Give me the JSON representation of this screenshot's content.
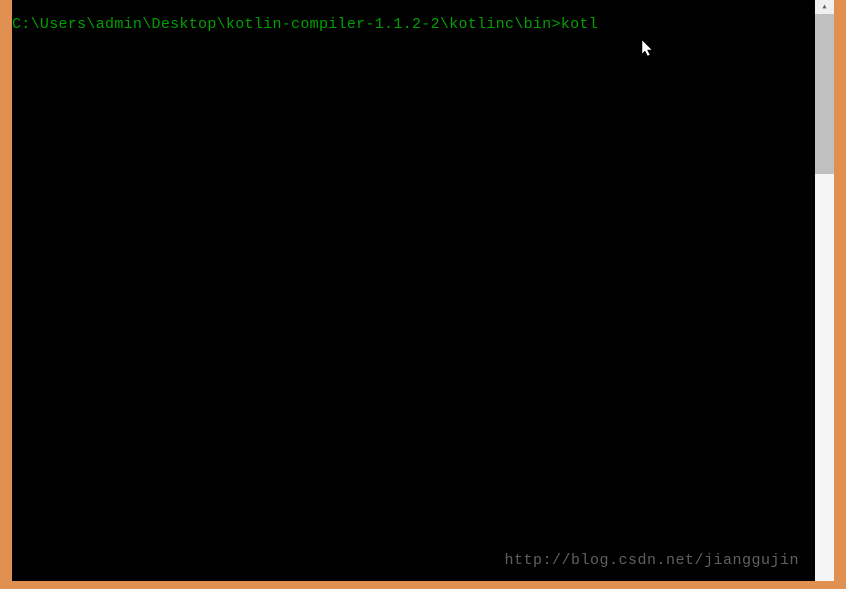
{
  "terminal": {
    "prompt": "C:\\Users\\admin\\Desktop\\kotlin-compiler-1.1.2-2\\kotlinc\\bin>",
    "command": "kotl"
  },
  "watermark": {
    "text": "http://blog.csdn.net/jianggujin"
  },
  "scrollbar": {
    "up_arrow": "▴"
  }
}
